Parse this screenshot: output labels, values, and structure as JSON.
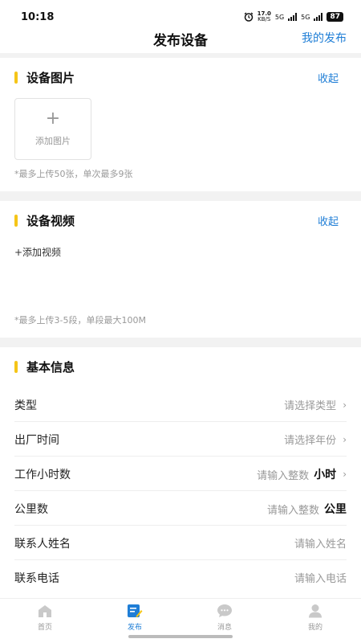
{
  "status": {
    "time": "10:18",
    "net_speed_value": "17.0",
    "net_speed_unit": "KB/S",
    "net1": "5G",
    "net2": "5G",
    "battery": "87"
  },
  "nav": {
    "title": "发布设备",
    "right_link": "我的发布"
  },
  "images": {
    "title": "设备图片",
    "collapse": "收起",
    "add_label": "添加图片",
    "note": "*最多上传50张，单次最多9张"
  },
  "video": {
    "title": "设备视频",
    "collapse": "收起",
    "add_label": "+添加视频",
    "note": "*最多上传3-5段，单段最大100M"
  },
  "basic": {
    "title": "基本信息",
    "rows": [
      {
        "label": "类型",
        "value": "请选择类型"
      },
      {
        "label": "出厂时间",
        "value": "请选择年份"
      },
      {
        "label": "工作小时数",
        "value": "请输入整数",
        "unit": "小时"
      },
      {
        "label": "公里数",
        "value": "请输入整数",
        "unit": "公里"
      },
      {
        "label": "联系人姓名",
        "value": "请输入姓名"
      },
      {
        "label": "联系电话",
        "value": "请输入电话"
      }
    ]
  },
  "tabs": [
    {
      "label": "首页",
      "icon": "home-icon"
    },
    {
      "label": "发布",
      "icon": "publish-icon",
      "active": true
    },
    {
      "label": "消息",
      "icon": "message-icon"
    },
    {
      "label": "我的",
      "icon": "profile-icon"
    }
  ],
  "colors": {
    "accent": "#1f7ed6",
    "section_marker": "#f5c518",
    "placeholder": "#999999"
  }
}
